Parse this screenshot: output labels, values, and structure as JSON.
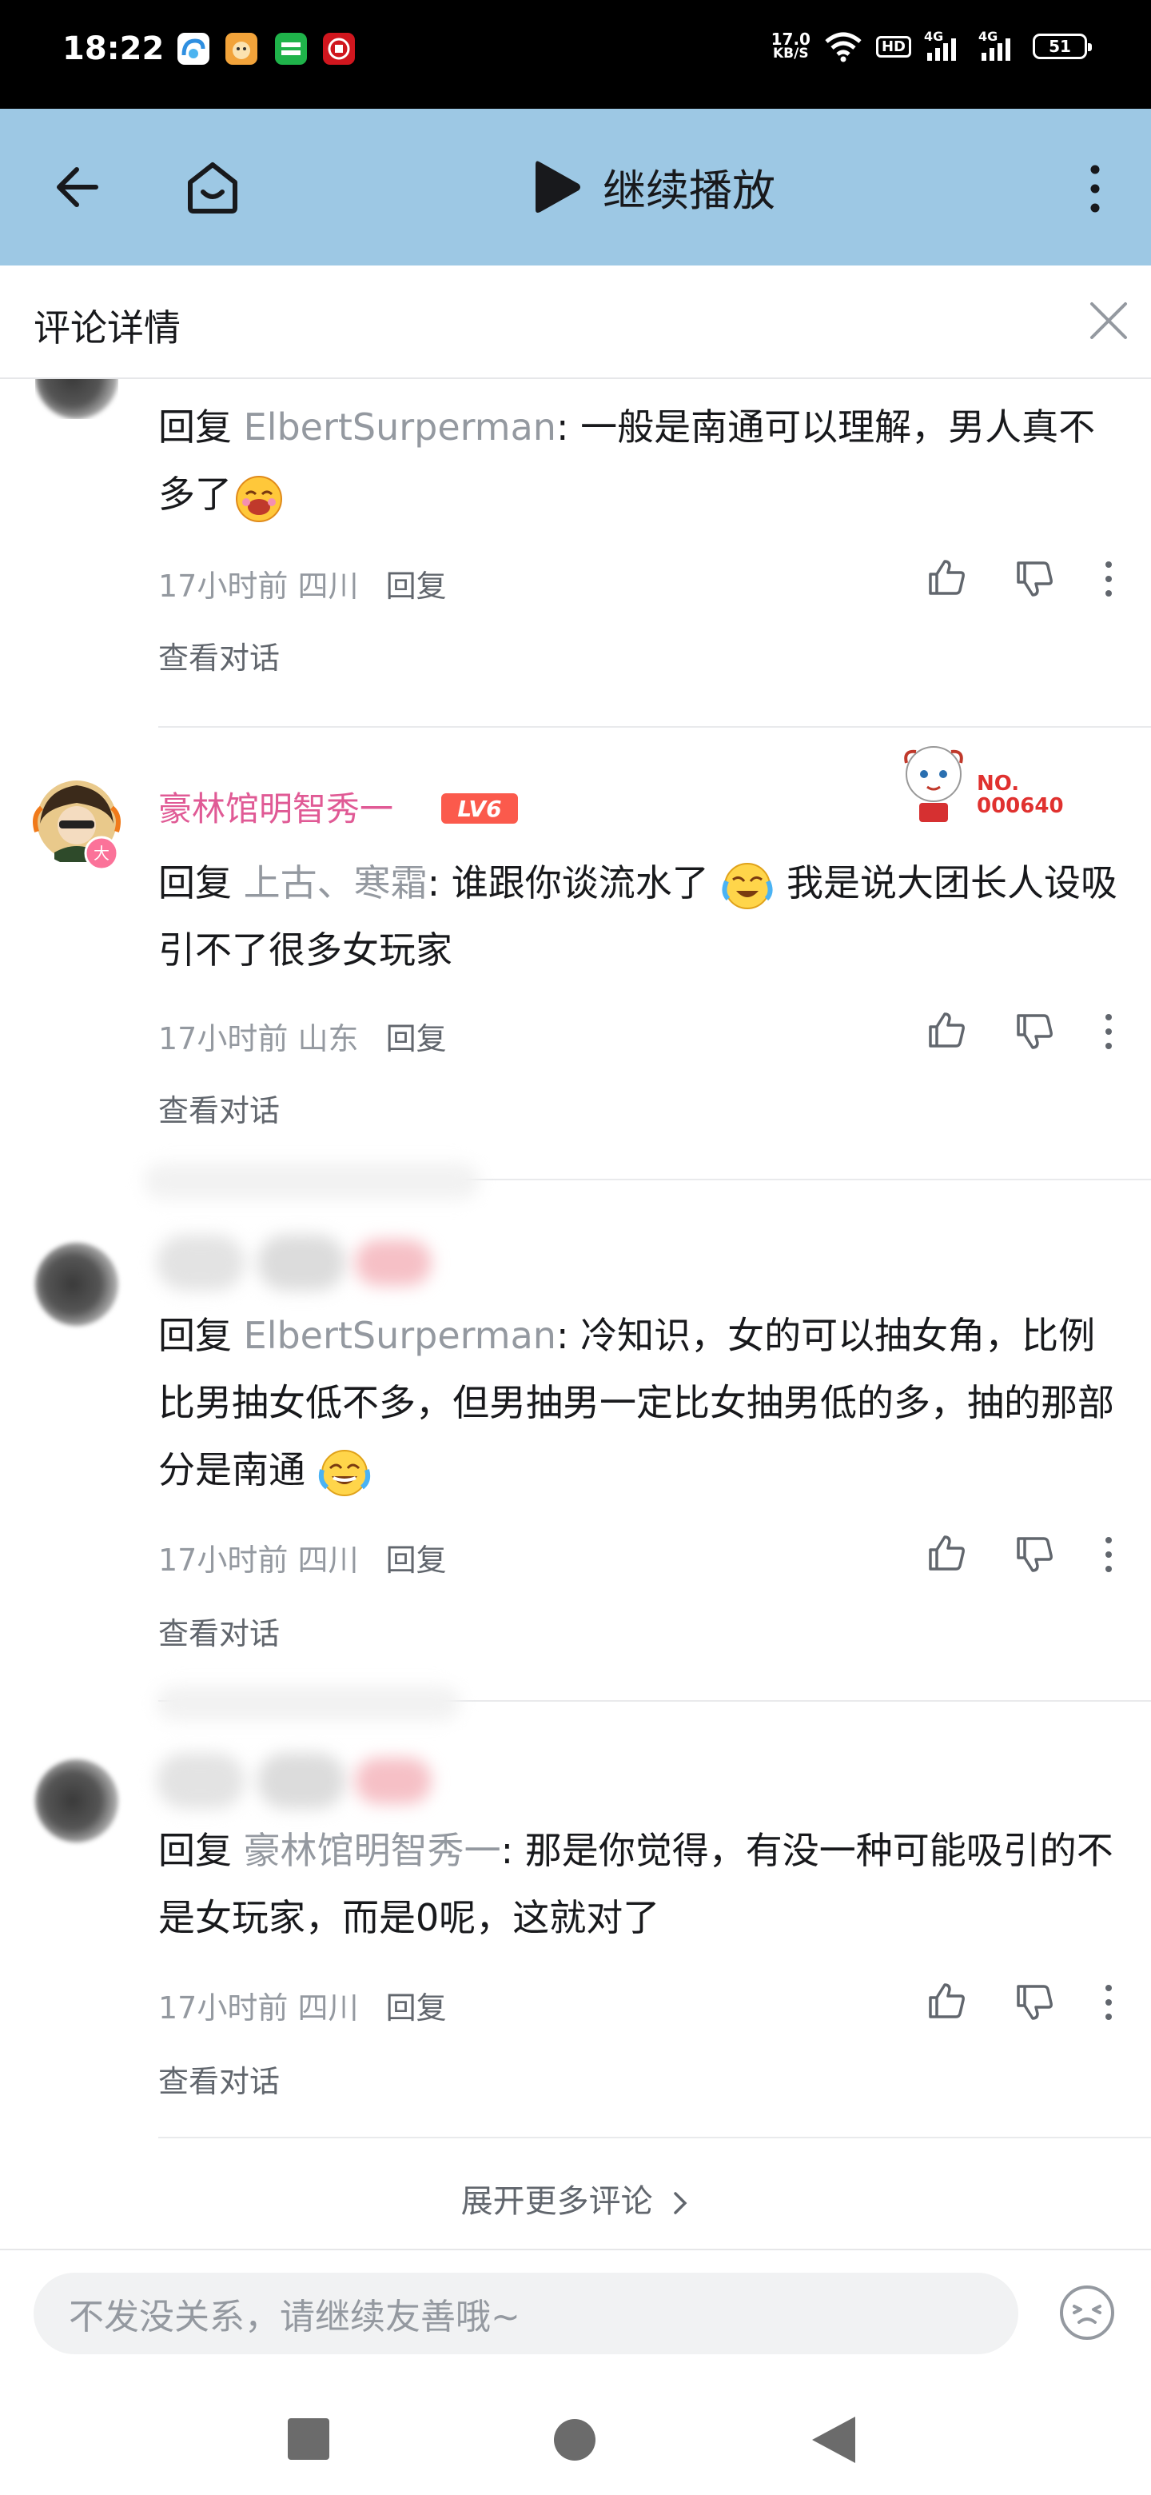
{
  "status_bar": {
    "time": "18:22",
    "net_speed_value": "17.0",
    "net_speed_unit": "KB/S",
    "hd": "HD",
    "signal_label": "4G",
    "battery": "51"
  },
  "top_bar": {
    "back_icon": "arrow-left-icon",
    "home_icon": "tv-home-icon",
    "continue_label": "继续播放",
    "more_icon": "more-vertical-icon"
  },
  "comment_panel": {
    "title": "评论详情",
    "close_icon": "close-icon"
  },
  "comments": [
    {
      "reply_prefix": "回复 ",
      "reply_to": "ElbertSurperman",
      "text": ": 一般是南通可以理解，男人真不多了",
      "time": "17小时前",
      "location": "四川",
      "reply_label": "回复",
      "view_label": "查看对话"
    },
    {
      "username": "豪林馆明智秀一",
      "level": "LV6",
      "fan_number_label": "NO.",
      "fan_number": "000640",
      "reply_prefix": "回复 ",
      "reply_to": "上古、寒霜",
      "text_a": ": 谁跟你谈流水了",
      "text_b": " 我是说大团长人设吸引不了很多女玩家",
      "time": "17小时前",
      "location": "山东",
      "reply_label": "回复",
      "view_label": "查看对话"
    },
    {
      "reply_prefix": "回复 ",
      "reply_to": "ElbertSurperman",
      "text": ": 冷知识，女的可以抽女角，比例比男抽女低不多，但男抽男一定比女抽男低的多，抽的那部分是南通",
      "time": "17小时前",
      "location": "四川",
      "reply_label": "回复",
      "view_label": "查看对话"
    },
    {
      "reply_prefix": "回复 ",
      "reply_to": "豪林馆明智秀一",
      "text": ": 那是你觉得，有没一种可能吸引的不是女玩家，而是0呢，这就对了",
      "time": "17小时前",
      "location": "四川",
      "reply_label": "回复",
      "view_label": "查看对话"
    }
  ],
  "more_comments_label": "展开更多评论",
  "input": {
    "placeholder": "不发没关系，请继续友善哦~",
    "emoji_icon": "emoji-face-icon"
  },
  "nav_bar": {
    "icons": [
      "recents-square-icon",
      "home-circle-icon",
      "back-triangle-icon"
    ]
  },
  "colors": {
    "top_bar_bg": "#9dc8e4",
    "username_pink": "#e05a95",
    "level_badge": "#fb5a4c",
    "secondary_text": "#9499a0"
  }
}
